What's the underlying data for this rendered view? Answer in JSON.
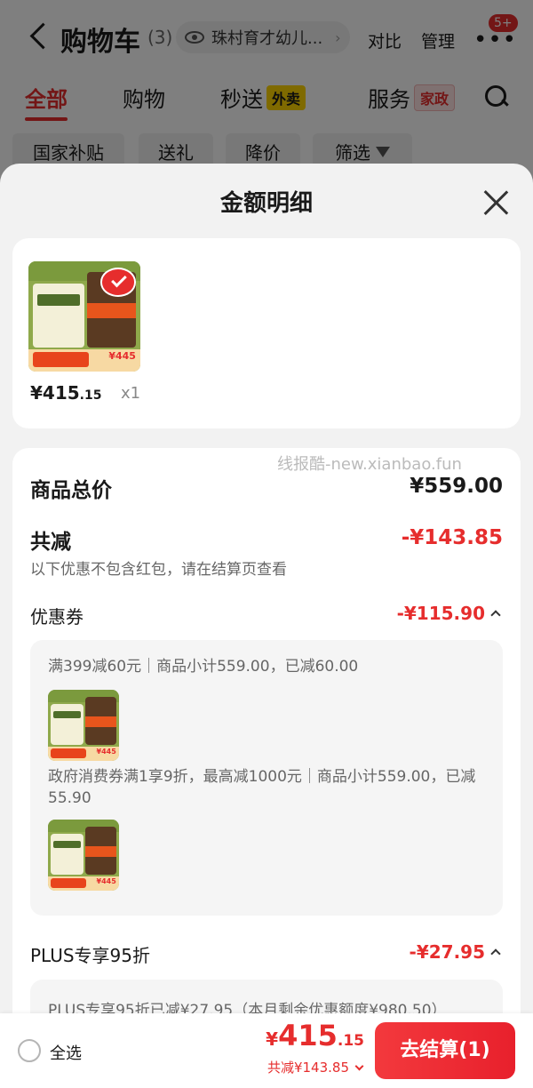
{
  "header": {
    "title": "购物车",
    "count": "(3)",
    "address": "珠村育才幼儿...",
    "compare_label": "对比",
    "manage_label": "管理",
    "badge": "5+"
  },
  "tabs": [
    {
      "label": "全部",
      "active": true
    },
    {
      "label": "购物"
    },
    {
      "label": "秒送",
      "tag": "外卖"
    },
    {
      "label": "服务",
      "tag": "家政"
    }
  ],
  "chips": [
    "国家补贴",
    "送礼",
    "降价",
    "筛选"
  ],
  "sheet": {
    "title": "金额明细",
    "product": {
      "price_int": "¥415",
      "price_dec": ".15",
      "qty": "x1",
      "thumb_price": "¥445"
    },
    "watermark": "线报酷-new.xianbao.fun",
    "subtotal": {
      "label": "商品总价",
      "value": "¥559.00"
    },
    "discount": {
      "label": "共减",
      "value": "-¥143.85",
      "note": "以下优惠不包含红包，请在结算页查看"
    },
    "coupon": {
      "label": "优惠券",
      "value": "-¥115.90",
      "items": [
        {
          "text": "满399减60元｜商品小计559.00，已减60.00"
        },
        {
          "text": "政府消费券满1享9折，最高减1000元｜商品小计559.00，已减55.90"
        }
      ]
    },
    "plus": {
      "label": "PLUS专享95折",
      "value": "-¥27.95",
      "detail": "PLUS专享95折已减¥27.95（本月剩余优惠额度¥980.50）"
    }
  },
  "bottom": {
    "select_all": "全选",
    "total_currency": "¥",
    "total_int": "415",
    "total_dec": ".15",
    "total_discount": "共减¥143.85",
    "checkout_label": "去结算(1)"
  },
  "colors": {
    "accent": "#e62d2d",
    "sheet_bg": "#f2f2f2",
    "card_bg": "#ffffff"
  }
}
